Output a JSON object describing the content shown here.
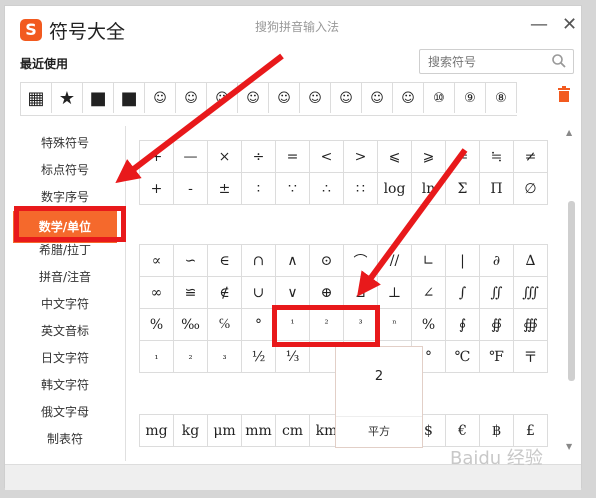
{
  "window": {
    "app_title": "符号大全",
    "input_method": "搜狗拼音输入法",
    "logo_letter": "S",
    "minimize": "—",
    "close": "✕",
    "accent_color": "#f5692c",
    "highlight_color": "#e8191b"
  },
  "recent": {
    "label": "最近使用",
    "items": [
      "▦",
      "★",
      "■",
      "■",
      "☺",
      "☺",
      "☺",
      "☺",
      "☺",
      "☺",
      "☺",
      "☺",
      "☺",
      "⑩",
      "⑨",
      "⑧"
    ]
  },
  "search": {
    "placeholder": "搜索符号",
    "icon": "search-icon"
  },
  "sidebar": {
    "items": [
      "特殊符号",
      "标点符号",
      "数字序号",
      "数学/单位",
      "希腊/拉丁",
      "拼音/注音",
      "中文字符",
      "英文音标",
      "日文字符",
      "韩文字符",
      "俄文字母",
      "制表符"
    ],
    "active_index": 3
  },
  "grid": {
    "block1": [
      [
        "+",
        "—",
        "×",
        "÷",
        "=",
        "<",
        ">",
        "⩽",
        "⩾",
        "≠",
        "≒",
        "≠"
      ],
      [
        "+",
        "-",
        "±",
        "∶",
        "∵",
        "∴",
        "∷",
        "log",
        "ln",
        "Σ",
        "Π",
        "∅"
      ]
    ],
    "block2": [
      [
        "∝",
        "∽",
        "∈",
        "∩",
        "∧",
        "⊙",
        "⌒",
        "//",
        "∟",
        "|",
        "∂",
        "∆"
      ],
      [
        "∞",
        "≌",
        "∉",
        "∪",
        "∨",
        "⊕",
        "⊿",
        "⊥",
        "∠",
        "∫",
        "∬",
        "∭"
      ],
      [
        "%",
        "‰",
        "℅",
        "°",
        "¹",
        "²",
        "³",
        "ⁿ",
        "%",
        "∮",
        "∯",
        "∰"
      ],
      [
        "₁",
        "₂",
        "₃",
        "½",
        "⅓",
        "",
        "",
        "",
        "°",
        "℃",
        "℉",
        "〒"
      ]
    ],
    "block3": [
      [
        "mg",
        "kg",
        "μm",
        "mm",
        "cm",
        "km",
        "",
        "",
        "$",
        "€",
        "฿",
        "£"
      ]
    ]
  },
  "popup": {
    "value": "2",
    "name": "平方"
  },
  "watermark": "Baidu 经验"
}
